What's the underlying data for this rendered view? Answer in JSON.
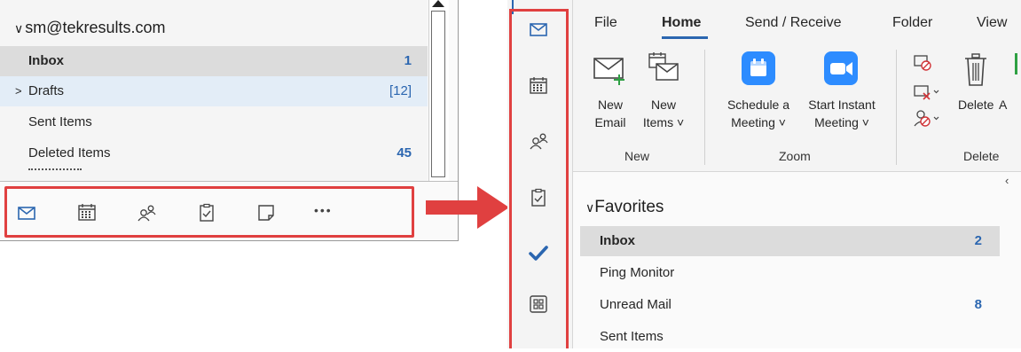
{
  "left_panel": {
    "account": "sm@tekresults.com",
    "folders": [
      {
        "label": "Inbox",
        "count": "1"
      },
      {
        "label": "Drafts",
        "count": "[12]"
      },
      {
        "label": "Sent Items",
        "count": ""
      },
      {
        "label": "Deleted Items",
        "count": "45"
      }
    ],
    "nav_icons": [
      "mail-icon",
      "calendar-icon",
      "people-icon",
      "tasks-icon",
      "notes-icon",
      "more-icon"
    ],
    "more_label": "•••"
  },
  "right_panel": {
    "tabs": [
      "File",
      "Home",
      "Send / Receive",
      "Folder",
      "View"
    ],
    "active_tab": "Home",
    "rail_icons": [
      "mail-icon",
      "calendar-icon",
      "people-icon",
      "tasks-icon",
      "todo-check-icon",
      "apps-icon"
    ],
    "ribbon": {
      "new_email": [
        "New",
        "Email"
      ],
      "new_items": [
        "New",
        "Items ˅"
      ],
      "schedule_meeting": [
        "Schedule a",
        "Meeting ˅"
      ],
      "start_instant": [
        "Start Instant",
        "Meeting ˅"
      ],
      "delete": "Delete",
      "cut_letter": "A",
      "groups": [
        "New",
        "Zoom",
        "Delete"
      ]
    },
    "favorites_header": "Favorites",
    "favorites": [
      {
        "label": "Inbox",
        "count": "2"
      },
      {
        "label": "Ping Monitor",
        "count": ""
      },
      {
        "label": "Unread Mail",
        "count": "8"
      },
      {
        "label": "Sent Items",
        "count": ""
      }
    ]
  },
  "colors": {
    "accent": "#2b66b0",
    "highlight_red": "#e04040",
    "zoom_blue": "#2d8cff",
    "selected_row": "#dcdcdc"
  }
}
